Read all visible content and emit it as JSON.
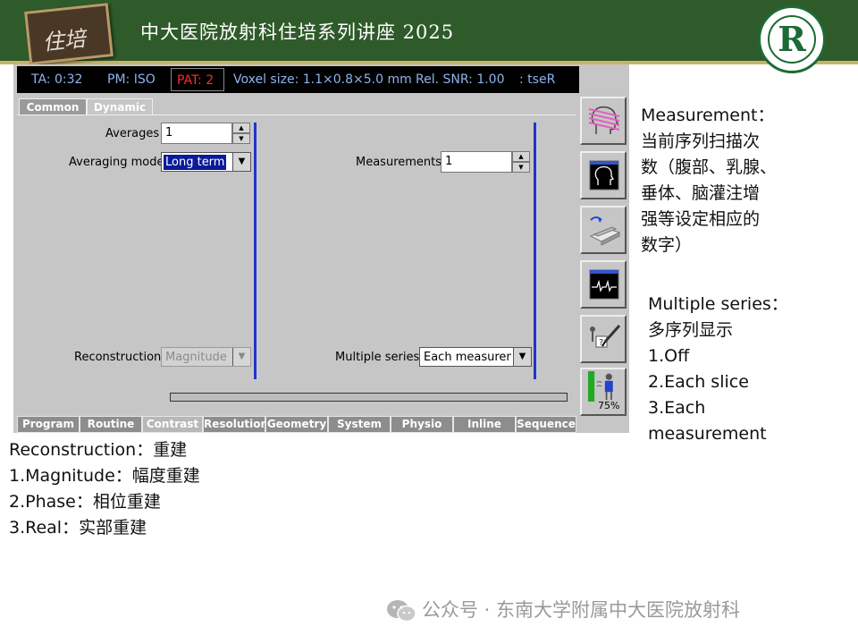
{
  "header": {
    "badge_text": "住培",
    "title": "中大医院放射科住培系列讲座 2025",
    "logo_letter": "R"
  },
  "status_bar": {
    "ta": "TA: 0:32",
    "pm": "PM: ISO",
    "pat": "PAT: 2",
    "voxel": "Voxel size: 1.1×0.8×5.0 mm",
    "snr": "Rel. SNR: 1.00",
    "seq": ": tseR"
  },
  "top_tabs": [
    "Common",
    "Dynamic"
  ],
  "form": {
    "averages_label": "Averages",
    "averages_value": "1",
    "averaging_mode_label": "Averaging mode",
    "averaging_mode_value": "Long term",
    "measurements_label": "Measurements",
    "measurements_value": "1",
    "reconstruction_label": "Reconstruction",
    "reconstruction_value": "Magnitude",
    "multiple_series_label": "Multiple series",
    "multiple_series_value": "Each measurem"
  },
  "bottom_tabs": [
    "Program",
    "Routine",
    "Contrast",
    "Resolution",
    "Geometry",
    "System",
    "Physio",
    "Inline",
    "Sequence"
  ],
  "side_panel": {
    "percent": "75%"
  },
  "notes": {
    "measurement": [
      "Measurement：",
      "当前序列扫描次",
      "数（腹部、乳腺、",
      "垂体、脑灌注增",
      "强等设定相应的",
      "数字）"
    ],
    "multiple_series": [
      "Multiple series：",
      "多序列显示",
      "1.Off",
      "2.Each slice",
      "3.Each",
      "measurement"
    ],
    "reconstruction": [
      "Reconstruction：重建",
      "1.Magnitude：幅度重建",
      "2.Phase：相位重建",
      "3.Real：实部重建"
    ]
  },
  "footer": {
    "text": "公众号 · 东南大学附属中大医院放射科"
  },
  "colors": {
    "banner": "#2f5a2a",
    "status_text": "#8fb3ee",
    "pat_text": "#ff2a2a",
    "divider": "#2233cc"
  }
}
